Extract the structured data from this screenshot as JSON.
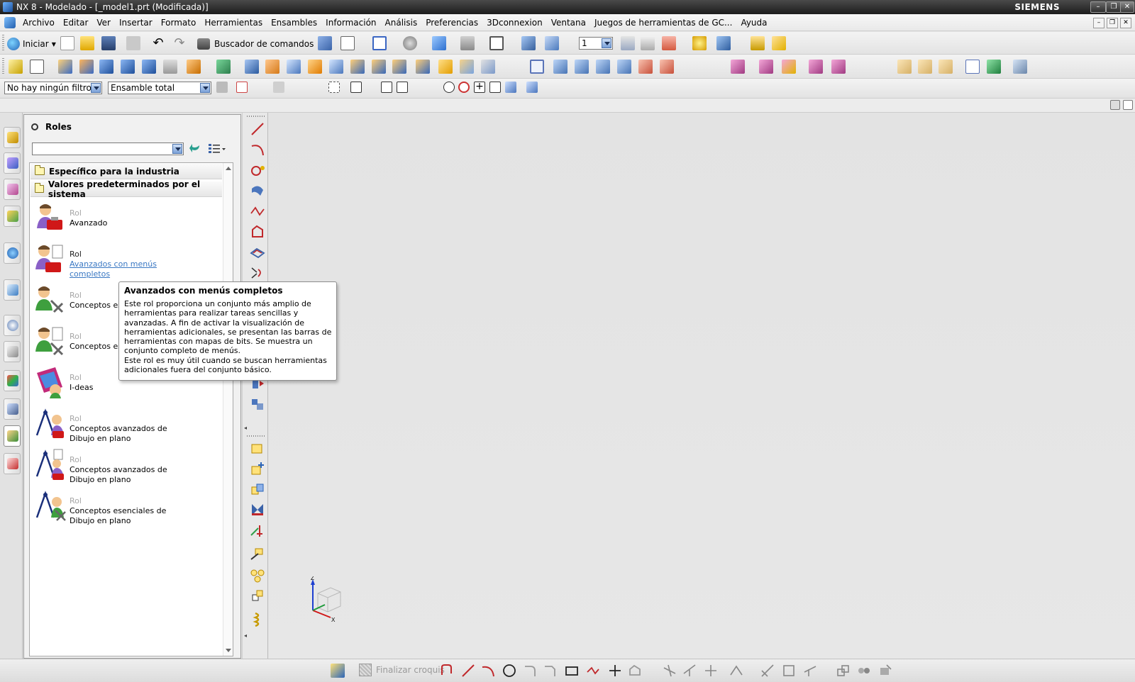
{
  "window": {
    "title": "NX 8 - Modelado - [_model1.prt (Modificada)]",
    "brand": "SIEMENS",
    "controls": [
      "–",
      "❐",
      "✕"
    ]
  },
  "menu": {
    "items": [
      "Archivo",
      "Editar",
      "Ver",
      "Insertar",
      "Formato",
      "Herramientas",
      "Ensambles",
      "Información",
      "Análisis",
      "Preferencias",
      "3Dconnexion",
      "Ventana",
      "Juegos de herramientas de GC...",
      "Ayuda"
    ]
  },
  "toolbar": {
    "start_label": "Iniciar",
    "finder_label": "Buscador de comandos",
    "work_layer": "1"
  },
  "filters": {
    "selection_filter": "No hay ningún filtro d",
    "assembly_scope": "Ensamble total"
  },
  "roles_panel": {
    "title": "Roles",
    "search_value": "",
    "groups": [
      "Específico para la industria",
      "Valores predeterminados por el sistema"
    ],
    "roles": [
      {
        "kind": "Rol",
        "name": "Avanzado"
      },
      {
        "kind": "Rol",
        "name": "Avanzados con menús completos"
      },
      {
        "kind": "Rol",
        "name": "Conceptos es (recomendad"
      },
      {
        "kind": "Rol",
        "name": "Conceptos es menús comp"
      },
      {
        "kind": "Rol",
        "name": "I-deas"
      },
      {
        "kind": "Rol",
        "name": "Conceptos avanzados de Dibujo en plano"
      },
      {
        "kind": "Rol",
        "name": "Conceptos avanzados de Dibujo en plano"
      },
      {
        "kind": "Rol",
        "name": "Conceptos esenciales de Dibujo en plano"
      }
    ]
  },
  "tooltip": {
    "title": "Avanzados con menús completos",
    "body": "Este rol proporciona un conjunto más amplio de\nherramientas para realizar tareas sencillas y\navanzadas. A fin de activar la visualización de\nherramientas adicionales, se presentan las barras de\nherramientas con mapas de bits. Se muestra un\nconjunto completo de menús.\nEste rol es muy útil cuando se buscan herramientas\nadicionales fuera del conjunto básico."
  },
  "triad": {
    "z_label": "Z",
    "x_label": "X"
  },
  "sketch_bar": {
    "finish_label": "Finalizar croquis"
  },
  "colors": {
    "accent_link": "#3a78c3",
    "canvas": "#e4e4e4",
    "titlebar": "#262626"
  }
}
